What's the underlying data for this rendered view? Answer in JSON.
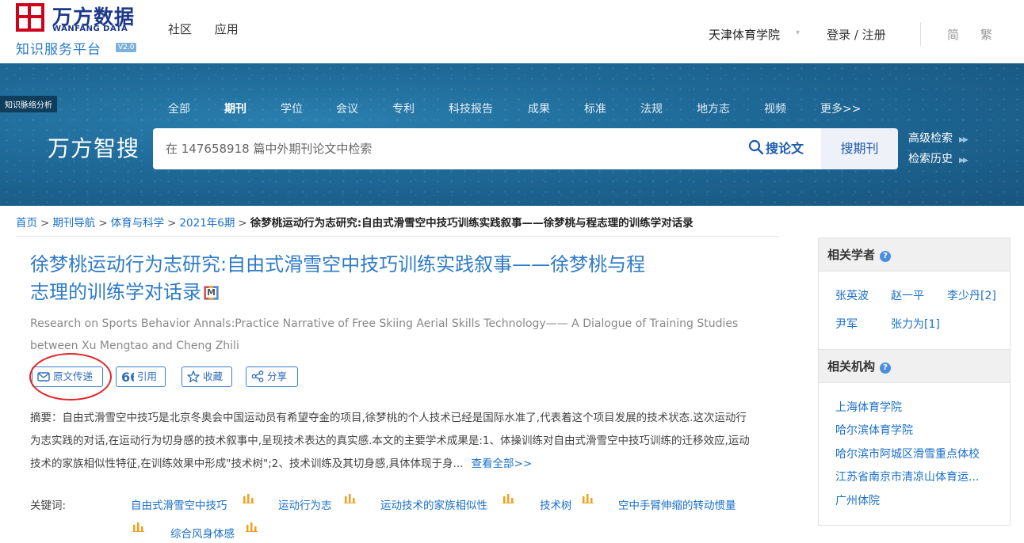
{
  "header": {
    "logo_cn": "万方数据",
    "logo_en": "WANFANG DATA",
    "logo_sub": "知识服务平台",
    "logo_version": "V2.0",
    "nav": [
      "社区",
      "应用"
    ],
    "institution": "天津体育学院",
    "login": "登录 / 注册",
    "lang_simplified": "简",
    "lang_traditional": "繁"
  },
  "banner": {
    "tag": "知识脉络分析",
    "categories": [
      "全部",
      "期刊",
      "学位",
      "会议",
      "专利",
      "科技报告",
      "成果",
      "标准",
      "法规",
      "地方志",
      "视频",
      "更多>>"
    ],
    "active_category": "期刊",
    "brand": "万方智搜",
    "search_placeholder": "在 147658918 篇中外期刊论文中检索",
    "search_paper_btn": "搜论文",
    "search_journal_btn": "搜期刊",
    "advanced_search": "高级检索",
    "search_history": "检索历史"
  },
  "breadcrumb": {
    "items": [
      "首页",
      "期刊导航",
      "体育与科学",
      "2021年6期"
    ],
    "current": "徐梦桃运动行为志研究:自由式滑雪空中技巧训练实践叙事——徐梦桃与程志理的训练学对话录"
  },
  "article": {
    "title_line1": "徐梦桃运动行为志研究:自由式滑雪空中技巧训练实践叙事——徐梦桃与程",
    "title_line2": "志理的训练学对话录",
    "en_title": "Research on Sports Behavior Annals:Practice Narrative of Free Skiing Aerial Skills Technology—— A Dialogue of Training Studies between Xu Mengtao and Cheng Zhili",
    "buttons": {
      "delivery": "原文传递",
      "cite": "引用",
      "favorite": "收藏",
      "share": "分享"
    },
    "abstract_label": "摘要：",
    "abstract": "自由式滑雪空中技巧是北京冬奥会中国运动员有希望夺金的项目,徐梦桃的个人技术已经是国际水准了,代表着这个项目发展的技术状态.这次运动行为志实践的对话,在运动行为切身感的技术叙事中,呈现技术表达的真实感.本文的主要学术成果是:1、体操训练对自由式滑雪空中技巧训练的迁移效应,运动技术的家族相似性特征,在训练效果中形成\"技术树\";2、技术训练及其切身感,具体体现于身...",
    "view_all": "查看全部>>",
    "keywords_label": "关键词:",
    "keywords": [
      "自由式滑雪空中技巧",
      "运动行为志",
      "运动技术的家族相似性",
      "技术树",
      "空中手臂伸缩的转动惯量",
      "综合风身体感"
    ]
  },
  "sidebar": {
    "scholars_title": "相关学者",
    "scholars": [
      "张英波",
      "赵一平",
      "李少丹[2]",
      "尹军",
      "张力为[1]"
    ],
    "orgs_title": "相关机构",
    "orgs": [
      "上海体育学院",
      "哈尔滨体育学院",
      "哈尔滨市阿城区滑雪重点体校",
      "江苏省南京市清凉山体育运...",
      "广州体院"
    ]
  },
  "colors": {
    "brand_red": "#d0021b",
    "brand_navy": "#1d3a8a",
    "link_blue": "#1a6fc9",
    "title_blue": "#2f7bc6",
    "banner_blue": "#1f6a98",
    "annotation_red": "#e0262b"
  }
}
